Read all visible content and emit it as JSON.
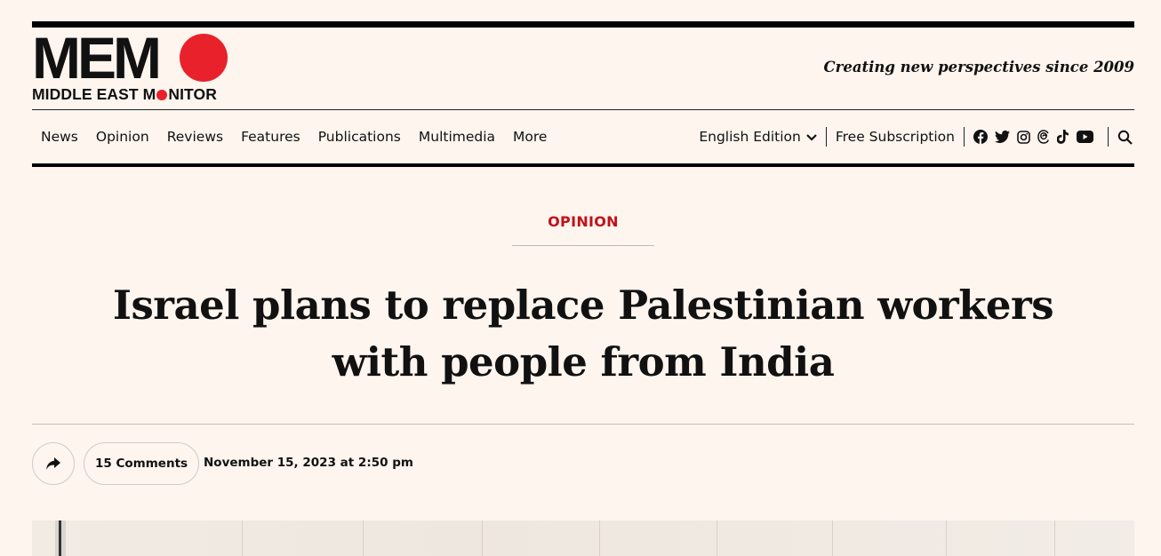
{
  "brand": {
    "logo_main": "MEM",
    "logo_sub_before": "MIDDLE EAST M",
    "logo_sub_after": "NITOR",
    "tagline": "Creating new perspectives since 2009",
    "accent_color": "#e8212a"
  },
  "nav": {
    "items": [
      "News",
      "Opinion",
      "Reviews",
      "Features",
      "Publications",
      "Multimedia",
      "More"
    ],
    "edition": "English Edition",
    "subscription": "Free Subscription",
    "social_icons": [
      "facebook-icon",
      "twitter-icon",
      "instagram-icon",
      "threads-icon",
      "tiktok-icon",
      "youtube-icon"
    ],
    "search_icon": "search-icon"
  },
  "article": {
    "category": "OPINION",
    "category_color": "#c0121b",
    "title": "Israel plans to replace Palestinian workers with people from India",
    "comments": "15 Comments",
    "date": "November 15, 2023 at 2:50 pm"
  }
}
